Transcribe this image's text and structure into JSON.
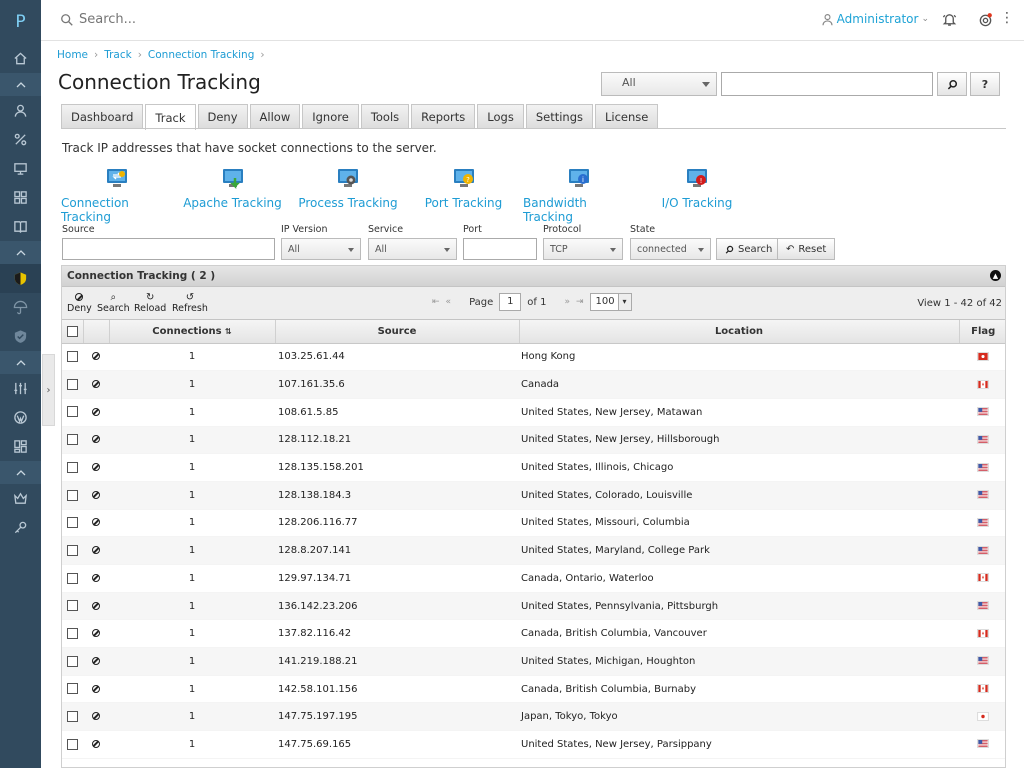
{
  "app": {
    "logo_letter": "P"
  },
  "topbar": {
    "search_placeholder": "Search...",
    "user_label": "Administrator"
  },
  "breadcrumb": [
    "Home",
    "Track",
    "Connection Tracking"
  ],
  "page_title": "Connection Tracking",
  "top_search": {
    "select_value": "All",
    "search_btn": "⌕",
    "help_btn": "?"
  },
  "tabs": [
    "Dashboard",
    "Track",
    "Deny",
    "Allow",
    "Ignore",
    "Tools",
    "Reports",
    "Logs",
    "Settings",
    "License"
  ],
  "active_tab": "Track",
  "description": "Track IP addresses that have socket connections to the server.",
  "tracking_links": [
    {
      "label": "Connection Tracking",
      "icon": "connection-monitor-icon"
    },
    {
      "label": "Apache Tracking",
      "icon": "apache-monitor-icon"
    },
    {
      "label": "Process Tracking",
      "icon": "process-monitor-icon"
    },
    {
      "label": "Port Tracking",
      "icon": "port-monitor-icon"
    },
    {
      "label": "Bandwidth Tracking",
      "icon": "bandwidth-monitor-icon"
    },
    {
      "label": "I/O Tracking",
      "icon": "io-monitor-icon"
    }
  ],
  "filters": {
    "source_label": "Source",
    "ipversion_label": "IP Version",
    "ipversion_value": "All",
    "service_label": "Service",
    "service_value": "All",
    "port_label": "Port",
    "protocol_label": "Protocol",
    "protocol_value": "TCP",
    "state_label": "State",
    "state_value": "connected",
    "search_btn": "Search",
    "reset_btn": "Reset"
  },
  "grid": {
    "caption": "Connection Tracking ( 2 )",
    "toolbar": {
      "deny": "Deny",
      "search": "Search",
      "reload": "Reload",
      "refresh": "Refresh"
    },
    "pager": {
      "page_label": "Page",
      "page": "1",
      "of_label": "of 1",
      "page_size": "100"
    },
    "view_info": "View 1 - 42 of 42",
    "columns": [
      "Connections",
      "Source",
      "Location",
      "Flag"
    ],
    "rows": [
      {
        "connections": "1",
        "source": "103.25.61.44",
        "location": "Hong Kong",
        "flag": "hk"
      },
      {
        "connections": "1",
        "source": "107.161.35.6",
        "location": "Canada",
        "flag": "ca"
      },
      {
        "connections": "1",
        "source": "108.61.5.85",
        "location": "United States, New Jersey, Matawan",
        "flag": "us"
      },
      {
        "connections": "1",
        "source": "128.112.18.21",
        "location": "United States, New Jersey, Hillsborough",
        "flag": "us"
      },
      {
        "connections": "1",
        "source": "128.135.158.201",
        "location": "United States, Illinois, Chicago",
        "flag": "us"
      },
      {
        "connections": "1",
        "source": "128.138.184.3",
        "location": "United States, Colorado, Louisville",
        "flag": "us"
      },
      {
        "connections": "1",
        "source": "128.206.116.77",
        "location": "United States, Missouri, Columbia",
        "flag": "us"
      },
      {
        "connections": "1",
        "source": "128.8.207.141",
        "location": "United States, Maryland, College Park",
        "flag": "us"
      },
      {
        "connections": "1",
        "source": "129.97.134.71",
        "location": "Canada, Ontario, Waterloo",
        "flag": "ca"
      },
      {
        "connections": "1",
        "source": "136.142.23.206",
        "location": "United States, Pennsylvania, Pittsburgh",
        "flag": "us"
      },
      {
        "connections": "1",
        "source": "137.82.116.42",
        "location": "Canada, British Columbia, Vancouver",
        "flag": "ca"
      },
      {
        "connections": "1",
        "source": "141.219.188.21",
        "location": "United States, Michigan, Houghton",
        "flag": "us"
      },
      {
        "connections": "1",
        "source": "142.58.101.156",
        "location": "Canada, British Columbia, Burnaby",
        "flag": "ca"
      },
      {
        "connections": "1",
        "source": "147.75.197.195",
        "location": "Japan, Tokyo, Tokyo",
        "flag": "jp"
      },
      {
        "connections": "1",
        "source": "147.75.69.165",
        "location": "United States, New Jersey, Parsippany",
        "flag": "us"
      }
    ]
  },
  "colors": {
    "sidebar_bg": "#314a5e",
    "link": "#1e9cd4",
    "flag_red": "#d52b1e",
    "flag_us_blue": "#3c5aa8"
  }
}
